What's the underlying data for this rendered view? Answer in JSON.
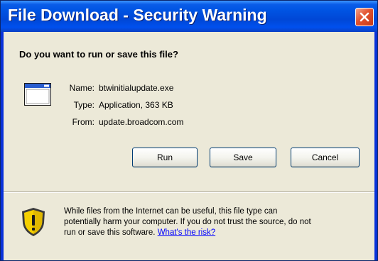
{
  "window": {
    "title": "File Download - Security Warning"
  },
  "dialog": {
    "question": "Do you want to run or save this file?",
    "file": {
      "name_label": "Name:",
      "name_value": "btwinitialupdate.exe",
      "type_label": "Type:",
      "type_value": "Application, 363 KB",
      "from_label": "From:",
      "from_value": "update.broadcom.com"
    },
    "buttons": {
      "run": "Run",
      "save": "Save",
      "cancel": "Cancel"
    },
    "warning": {
      "text_line1": "While files from the Internet can be useful, this file type can",
      "text_line2": "potentially harm your computer. If you do not trust the source, do not",
      "text_line3": "run or save this software.",
      "link": "What's the risk?"
    }
  },
  "icons": {
    "title_close": "close-icon",
    "file": "application-window-icon",
    "warning": "security-shield-icon"
  },
  "colors": {
    "titlebar": "#0054e3",
    "dialog_bg": "#ece9d8",
    "close_button": "#e2522f",
    "link": "#0000ff",
    "shield_yellow": "#f5d000"
  }
}
